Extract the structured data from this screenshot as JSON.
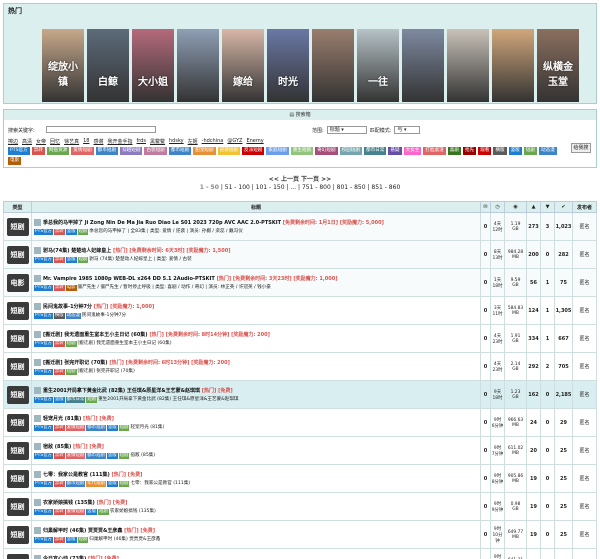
{
  "hot": {
    "title": "热门",
    "posters": [
      {
        "text": "绽放小镇",
        "bg": "#c7a98b"
      },
      {
        "text": "白鲸",
        "bg": "#5d6b7a"
      },
      {
        "text": "大小姐",
        "bg": "#b56a7c"
      },
      {
        "text": "",
        "bg": "#8f9fb5"
      },
      {
        "text": "嫁给",
        "bg": "#d8b7a8"
      },
      {
        "text": "时光",
        "bg": "#6a78a5"
      },
      {
        "text": "",
        "bg": "#9a7e6e"
      },
      {
        "text": "一往",
        "bg": "#b7c3c7"
      },
      {
        "text": "",
        "bg": "#7e8aa0"
      },
      {
        "text": "",
        "bg": "#c9c2b9"
      },
      {
        "text": "",
        "bg": "#d1a77c"
      },
      {
        "text": "纵横金玉堂",
        "bg": "#8b6f5f"
      }
    ]
  },
  "search": {
    "header": "搜索箱",
    "keyword_label": "搜索关键字:",
    "scope_label": "范围:",
    "scope_value": "标题",
    "match_label": "匹配模式:",
    "match_value": "与",
    "button": "给我搜",
    "hot_words": [
      "擦边",
      "高清",
      "女帝",
      "回忆",
      "徐艺真",
      "18",
      "感谢",
      "我开金手指",
      "frds",
      "黑鳖鳖",
      "hdsky",
      "左姬",
      "-hdchina",
      "@GYZ",
      "Enemy"
    ],
    "tags": [
      {
        "label": "PTS官方",
        "color": "#1e7fd0"
      },
      {
        "label": "禁转",
        "color": "#d9534f"
      },
      {
        "label": "网盘资源",
        "color": "#6aa84f"
      },
      {
        "label": "爱情短剧",
        "color": "#e06666"
      },
      {
        "label": "都市短剧",
        "color": "#3d85c6"
      },
      {
        "label": "穿越短剧",
        "color": "#8e7cc3"
      },
      {
        "label": "古装短剧",
        "color": "#c27ba0"
      },
      {
        "label": "都市短剧",
        "color": "#3d85c6"
      },
      {
        "label": "甜宠短剧",
        "color": "#e69138"
      },
      {
        "label": "逆袭短剧",
        "color": "#f1c232"
      },
      {
        "label": "反派短剧",
        "color": "#cc0000"
      },
      {
        "label": "家庭短剧",
        "color": "#6d9eeb"
      },
      {
        "label": "重生短剧",
        "color": "#93c47d"
      },
      {
        "label": "奇幻短剧",
        "color": "#a64d79"
      },
      {
        "label": "校园短剧",
        "color": "#76a5af"
      },
      {
        "label": "都市日常",
        "color": "#45818e"
      },
      {
        "label": "悬疑",
        "color": "#674ea7"
      },
      {
        "label": "大女主",
        "color": "#ff66cc"
      },
      {
        "label": "打脸虐渣",
        "color": "#e06666"
      },
      {
        "label": "喜剧",
        "color": "#38761d"
      },
      {
        "label": "抢先",
        "color": "#990000"
      },
      {
        "label": "观看",
        "color": "#cc0000"
      },
      {
        "label": "横版",
        "color": "#5b5b5b"
      },
      {
        "label": "竖版",
        "color": "#1e7fd0"
      },
      {
        "label": "短剧",
        "color": "#6aa84f"
      },
      {
        "label": "动态漫",
        "color": "#3d85c6"
      },
      {
        "label": "电影",
        "color": "#b45f06"
      }
    ]
  },
  "pager": {
    "nav": "<< 上一页     下一页 >>",
    "current": "1 - 50",
    "pages": " | 51 - 100 | 101 - 150 | ... | 751 - 800 | 801 - 850 | 851 - 860"
  },
  "columns": [
    "类型",
    "标题",
    "",
    "",
    "",
    "",
    "",
    "",
    "",
    "发布者"
  ],
  "rows": [
    {
      "type": "短剧",
      "title": "季总我的马甲掉了 Ji Zong Nin De Ma Jia Ruo Diao Le S01 2023 720p AVC AAC 2.0-PTSKIT",
      "flags": "[免费剩余时间: 1月1日] [奖励魔力: 5,000]",
      "labels": [
        "PTS官方",
        "禁转",
        "竖版",
        "短剧"
      ],
      "sub": "季总您的马甲掉了 | 全83集 | 类型: 爱情 / 逆袭 | 演员: 孙樾 / 栾蕊 / 戴冯仪",
      "rating": "N/A",
      "comments": "0",
      "time": "4天\n12时",
      "size": "1.19\nGB",
      "seed": "273",
      "leech": "3",
      "done": "1,023",
      "uploader": "匿名",
      "cls": "sticky"
    },
    {
      "type": "短剧",
      "title": "驸马(74集) 楚楚动人妃嫁皇上",
      "flags": "[热门] [免费剩余时间: 6天3时] [奖励魔力: 1,500]",
      "labels": [
        "PTS官方",
        "禁转",
        "竖版",
        "短剧"
      ],
      "sub": "驸马 (74集) 楚楚动人妃嫁皇上 | 类型: 爱情 / 古装",
      "rating": "N/A",
      "comments": "0",
      "time": "8天\n13时",
      "size": "984.28\nMB",
      "seed": "200",
      "leech": "0",
      "done": "282",
      "uploader": "匿名",
      "cls": "sticky"
    },
    {
      "type": "电影",
      "title": "Mr. Vampire 1985 1080p WEB-DL x264 DD 5.1 2Audio-PTSKIT",
      "flags": "[热门] [免费剩余时间: 3天23时] [奖励魔力: 1,000]",
      "labels": [
        "PTS官方",
        "禁转",
        "电影"
      ],
      "sub": "僵尸先生 / 僵尸先生 / 暂时停止呼吸 | 类型: 喜剧 / 动作 / 奇幻 | 演员: 林正英 / 许冠英 / 钱小豪",
      "rating": "7.3",
      "comments": "0",
      "time": "1天\n18时",
      "size": "9.59\nGB",
      "seed": "56",
      "leech": "1",
      "done": "75",
      "uploader": "匿名",
      "cls": "sticky"
    },
    {
      "type": "短剧",
      "title": "民间鬼故事-1分钟7分",
      "flags": "[热门] [奖励魔力: 1,000]",
      "labels": [
        "PTS官方",
        "横版",
        "动态漫"
      ],
      "sub": "民间鬼故事-1分钟7分",
      "rating": "N/A",
      "comments": "0",
      "time": "3天\n11时",
      "size": "584.83\nMB",
      "seed": "124",
      "leech": "1",
      "done": "1,305",
      "uploader": "匿名",
      "cls": ""
    },
    {
      "type": "短剧",
      "title": "[搬迁剧] 我无遗面重生室本王小主日记 (60集)",
      "flags": "[热门] [免费剩余时间: 8时14分钟] [奖励魔力: 200]",
      "labels": [
        "PTS官方",
        "禁转",
        "短剧"
      ],
      "sub": "[搬迁剧] 我无遗面重生室本王小主日记 (60集)",
      "rating": "N/A",
      "comments": "0",
      "time": "4天\n23时",
      "size": "1.91\nGB",
      "seed": "334",
      "leech": "1",
      "done": "667",
      "uploader": "匿名",
      "cls": ""
    },
    {
      "type": "短剧",
      "title": "[搬迁剧] 张完开职记 (70集)",
      "flags": "[热门] [免费剩余时间: 6时13分钟] [奖励魔力: 200]",
      "labels": [
        "PTS官方",
        "禁转",
        "短剧"
      ],
      "sub": "[搬迁剧] 张完开职记 (70集)",
      "rating": "N/A",
      "comments": "0",
      "time": "4天\n23时",
      "size": "2.14\nGB",
      "seed": "292",
      "leech": "2",
      "done": "705",
      "uploader": "匿名",
      "cls": ""
    },
    {
      "type": "短剧",
      "title": "重生2001开局拿下黄金比武 (82集) 王任琪&原星洋&王艺蒙&赵琪琪",
      "flags": "[热门] [免费]",
      "labels": [
        "PTS官方",
        "竖版",
        "都市日常",
        "短剧"
      ],
      "sub": "重生2001开局拿下黄金比武 (82集) 王任琪&原星洋&王艺蒙&赵琪琪",
      "rating": "N/A",
      "comments": "0",
      "time": "9天\n18时",
      "size": "1.23\nGB",
      "seed": "162",
      "leech": "0",
      "done": "2,185",
      "uploader": "匿名",
      "cls": "hl"
    },
    {
      "type": "短剧",
      "title": "轻宠月光 (81集)",
      "flags": "[热门] [免费]",
      "labels": [
        "PTS官方",
        "禁转",
        "爱情短剧",
        "都市短剧",
        "竖版",
        "短剧"
      ],
      "sub": "轻宠月光 (81集)",
      "rating": "N/A",
      "comments": "0",
      "time": "9时\n6分钟",
      "size": "966.63\nMB",
      "seed": "24",
      "leech": "0",
      "done": "29",
      "uploader": "匿名",
      "cls": ""
    },
    {
      "type": "短剧",
      "title": "宿敌 (85集)",
      "flags": "[热门] [免费]",
      "labels": [
        "PTS官方",
        "禁转",
        "爱情短剧",
        "都市短剧",
        "竖版",
        "短剧"
      ],
      "sub": "宿敌 (85集)",
      "rating": "N/A",
      "comments": "0",
      "time": "9时\n7分钟",
      "size": "611.02\nMB",
      "seed": "20",
      "leech": "0",
      "done": "25",
      "uploader": "匿名",
      "cls": ""
    },
    {
      "type": "短剧",
      "title": "七零：我家公是教官 (111集)",
      "flags": "[热门] [免费]",
      "labels": [
        "PTS官方",
        "禁转",
        "都市短剧",
        "年代短剧",
        "竖版",
        "短剧"
      ],
      "sub": "七零：我家公是教官 (111集)",
      "rating": "N/A",
      "comments": "0",
      "time": "9时\n8分钟",
      "size": "905.86\nMB",
      "seed": "19",
      "leech": "0",
      "done": "25",
      "uploader": "匿名",
      "cls": ""
    },
    {
      "type": "短剧",
      "title": "农家娇娘搞钱 (135集)",
      "flags": "[热门] [免费]",
      "labels": [
        "PTS官方",
        "禁转",
        "爱情短剧",
        "竖版",
        "短剧"
      ],
      "sub": "农家娇娘搞钱 (135集)",
      "rating": "N/A",
      "comments": "0",
      "time": "9时\n9分钟",
      "size": "0.98\nGB",
      "seed": "19",
      "leech": "0",
      "done": "25",
      "uploader": "匿名",
      "cls": ""
    },
    {
      "type": "短剧",
      "title": "归巢解甲时 (46集) 贾贾贾&王彦鑫",
      "flags": "[热门] [免费]",
      "labels": [
        "PTS官方",
        "禁转",
        "竖版",
        "短剧"
      ],
      "sub": "归巢解甲时 (46集) 贾贾贾&王彦鑫",
      "rating": "N/A",
      "comments": "0",
      "time": "9时\n10分钟",
      "size": "649.77\nMB",
      "seed": "19",
      "leech": "0",
      "done": "25",
      "uploader": "匿名",
      "cls": ""
    },
    {
      "type": "短剧",
      "title": "今日宜心动 (73集)",
      "flags": "[热门] [免费]",
      "labels": [
        "PTS官方",
        "禁转",
        "爱情短剧",
        "都市短剧",
        "竖版",
        "短剧"
      ],
      "sub": "今日宜心动 (73集)",
      "rating": "N/A",
      "comments": "0",
      "time": "9时\n13分钟",
      "size": "641.31\nMB",
      "seed": "20",
      "leech": "0",
      "done": "27",
      "uploader": "匿名",
      "cls": ""
    }
  ],
  "label_colors": {
    "PTS官方": "#1e7fd0",
    "禁转": "#d9534f",
    "竖版": "#1e7fd0",
    "短剧": "#6aa84f",
    "电影": "#b45f06",
    "横版": "#5b5b5b",
    "动态漫": "#3d85c6",
    "都市日常": "#45818e",
    "爱情短剧": "#e06666",
    "都市短剧": "#3d85c6",
    "年代短剧": "#e69138"
  }
}
